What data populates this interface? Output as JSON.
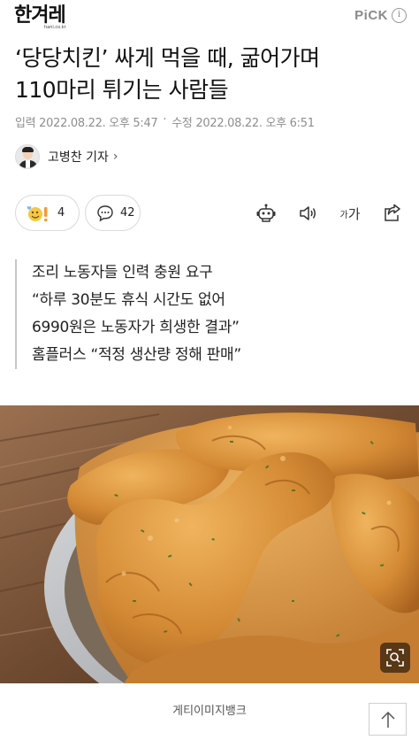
{
  "header": {
    "logo": "한겨레",
    "logo_sub": "hani.co.kr",
    "pick_label": "PiCK",
    "pick_info_icon": "info-icon"
  },
  "article": {
    "headline_line1": "‘당당치킨’ 싸게 먹을 때, 굶어가며",
    "headline_line2": "110마리 튀기는 사람들",
    "published_label": "입력",
    "published": "2022.08.22. 오후 5:47",
    "modified_label": "수정",
    "modified": "2022.08.22. 오후 6:51",
    "reporter": "고병찬 기자",
    "reporter_chevron": "›"
  },
  "actions": {
    "reaction_count": "4",
    "comment_count": "42",
    "font_size_small": "가",
    "font_size_large": "가",
    "icons": [
      "robot-icon",
      "speaker-icon",
      "font-size-icon",
      "share-icon"
    ]
  },
  "summary": [
    "조리 노동자들 인력 충원 요구",
    "“하루 30분도 휴식 시간도 없어",
    "6990원은 노동자가 희생한 결과”",
    "홈플러스 “적정 생산량 정해 판매”"
  ],
  "photo": {
    "caption": "게티이미지뱅크",
    "zoom_icon": "zoom-icon"
  },
  "footer": {
    "scroll_top_icon": "arrow-up-icon"
  },
  "colors": {
    "text": "#111111",
    "meta": "#8e8e8e",
    "border": "#dadada",
    "chicken": "#d9953f"
  }
}
